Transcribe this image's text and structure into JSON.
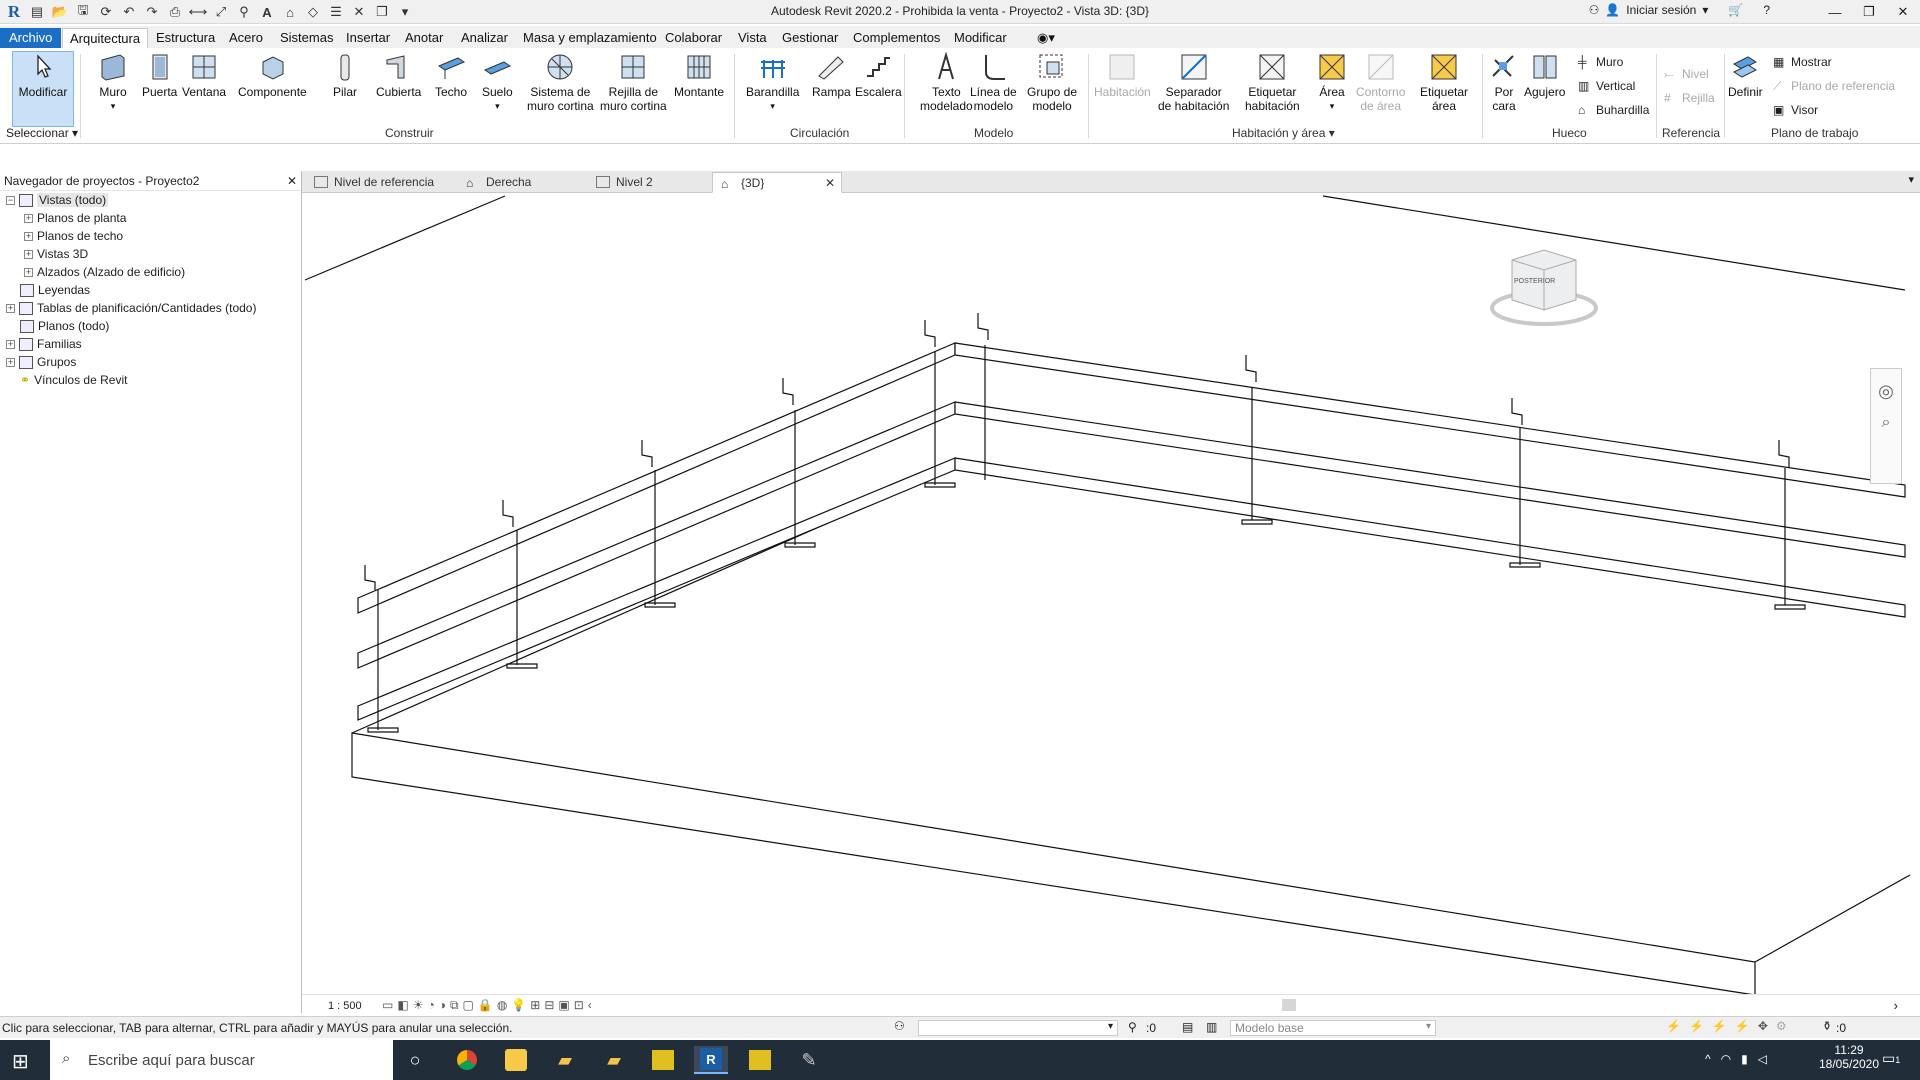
{
  "window": {
    "title": "Autodesk Revit 2020.2 - Prohibida la venta - Proyecto2 - Vista 3D: {3D}",
    "signin": "Iniciar sesión"
  },
  "menu": {
    "tabs": [
      "Archivo",
      "Arquitectura",
      "Estructura",
      "Acero",
      "Sistemas",
      "Insertar",
      "Anotar",
      "Analizar",
      "Masa y emplazamiento",
      "Colaborar",
      "Vista",
      "Gestionar",
      "Complementos",
      "Modificar"
    ]
  },
  "ribbon": {
    "modificar": "Modificar",
    "seleccionar": "Seleccionar",
    "construir": {
      "panel": "Construir",
      "muro": "Muro",
      "puerta": "Puerta",
      "ventana": "Ventana",
      "componente": "Componente",
      "pilar": "Pilar",
      "cubierta": "Cubierta",
      "techo": "Techo",
      "suelo": "Suelo",
      "sistema_l1": "Sistema de",
      "sistema_l2": "muro cortina",
      "rejilla_l1": "Rejilla de",
      "rejilla_l2": "muro cortina",
      "montante": "Montante"
    },
    "circulacion": {
      "panel": "Circulación",
      "barandilla": "Barandilla",
      "rampa": "Rampa",
      "escalera": "Escalera"
    },
    "modelo": {
      "panel": "Modelo",
      "texto_l1": "Texto",
      "texto_l2": "modelado",
      "linea_l1": "Línea de",
      "linea_l2": "modelo",
      "grupo_l1": "Grupo de",
      "grupo_l2": "modelo"
    },
    "habitacion": {
      "panel": "Habitación y área",
      "habitacion": "Habitación",
      "separador_l1": "Separador",
      "separador_l2": "de habitación",
      "etiquetar_hab_l1": "Etiquetar",
      "etiquetar_hab_l2": "habitación",
      "area": "Área",
      "contorno_l1": "Contorno",
      "contorno_l2": "de área",
      "etiquetar_area_l1": "Etiquetar",
      "etiquetar_area_l2": "área"
    },
    "hueco": {
      "panel": "Hueco",
      "por_l1": "Por",
      "por_l2": "cara",
      "agujero": "Agujero",
      "muro": "Muro",
      "vertical": "Vertical",
      "buhardilla": "Buhardilla"
    },
    "referencia": {
      "panel": "Referencia",
      "nivel": "Nivel",
      "rejilla": "Rejilla"
    },
    "plano": {
      "panel": "Plano de trabajo",
      "definir": "Definir",
      "mostrar": "Mostrar",
      "plano_ref": "Plano de referencia",
      "visor": "Visor"
    }
  },
  "browser": {
    "title": "Navegador de proyectos - Proyecto2",
    "items": [
      "Vistas (todo)",
      "Planos de planta",
      "Planos de techo",
      "Vistas 3D",
      "Alzados (Alzado de edificio)",
      "Leyendas",
      "Tablas de planificación/Cantidades (todo)",
      "Planos (todo)",
      "Familias",
      "Grupos",
      "Vínculos de Revit"
    ]
  },
  "view_tabs": [
    "Nivel de referencia",
    "Derecha",
    "Nivel 2",
    "{3D}"
  ],
  "viewcube_label": "POSTERIOR",
  "view": {
    "scale": "1 : 500"
  },
  "status": {
    "hint": "Clic para seleccionar, TAB para alternar, CTRL para añadir y MAYÚS para anular una selección.",
    "count": ":0",
    "model": "Modelo base",
    "filter": ":0"
  },
  "taskbar": {
    "search": "Escribe aquí para buscar",
    "time": "11:29",
    "date": "18/05/2020",
    "notif": "1"
  },
  "colors": {
    "accent": "#1a6ec5",
    "taskbar": "#222d3a"
  }
}
